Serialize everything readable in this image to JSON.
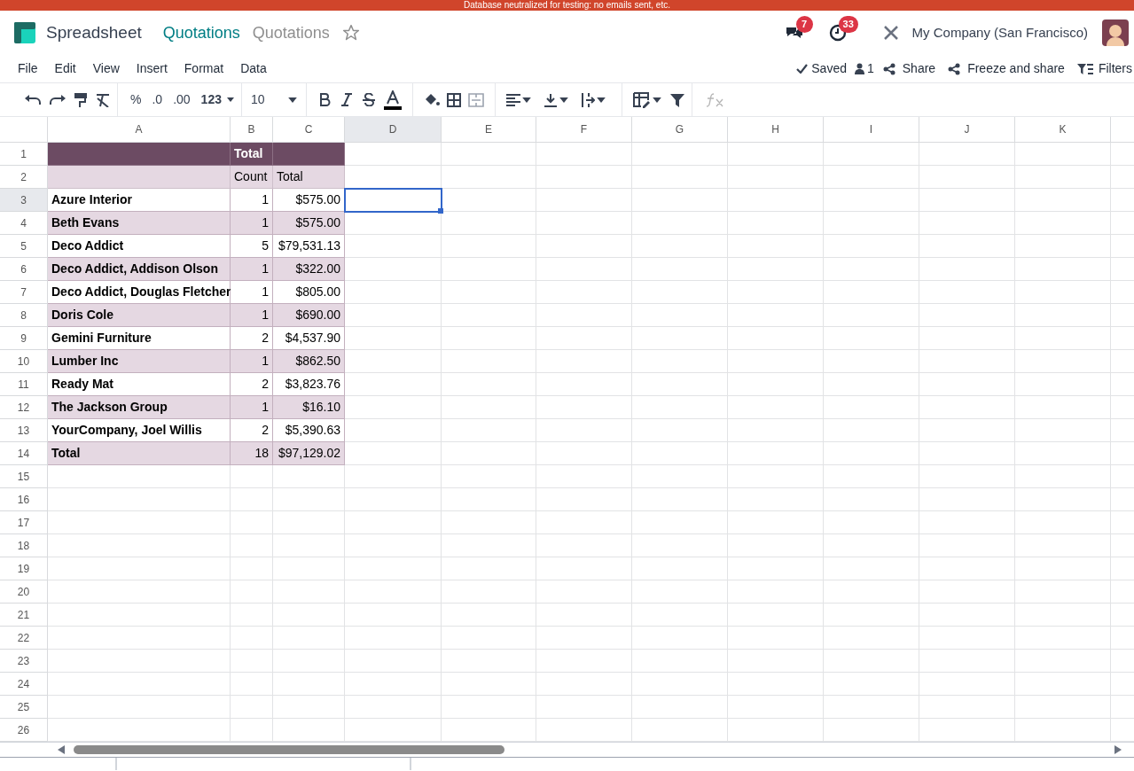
{
  "banner": "Database neutralized for testing: no emails sent, etc.",
  "nav": {
    "app": "Spreadsheet",
    "breadcrumb": "Quotations",
    "document": "Quotations",
    "favorite": false,
    "messages_count": "7",
    "activities_count": "33",
    "company": "My Company (San Francisco)"
  },
  "menu": [
    "File",
    "Edit",
    "View",
    "Insert",
    "Format",
    "Data"
  ],
  "actions": {
    "saved": "Saved",
    "users": "1",
    "share": "Share",
    "freeze": "Freeze and share",
    "filters": "Filters"
  },
  "toolbar": {
    "number_formats": [
      "%",
      ".0",
      ".00",
      "123"
    ],
    "font_size": "10"
  },
  "columns": [
    {
      "label": "A",
      "selected": false
    },
    {
      "label": "B",
      "selected": false
    },
    {
      "label": "C",
      "selected": false
    },
    {
      "label": "D",
      "selected": true
    },
    {
      "label": "E",
      "selected": false
    },
    {
      "label": "F",
      "selected": false
    },
    {
      "label": "G",
      "selected": false
    },
    {
      "label": "H",
      "selected": false
    },
    {
      "label": "I",
      "selected": false
    },
    {
      "label": "J",
      "selected": false
    },
    {
      "label": "K",
      "selected": false
    }
  ],
  "row_numbers": [
    {
      "label": "1",
      "selected": false
    },
    {
      "label": "2",
      "selected": false
    },
    {
      "label": "3",
      "selected": true
    },
    {
      "label": "4",
      "selected": false
    },
    {
      "label": "5",
      "selected": false
    },
    {
      "label": "6",
      "selected": false
    },
    {
      "label": "7",
      "selected": false
    },
    {
      "label": "8",
      "selected": false
    },
    {
      "label": "9",
      "selected": false
    },
    {
      "label": "10",
      "selected": false
    },
    {
      "label": "11",
      "selected": false
    },
    {
      "label": "12",
      "selected": false
    },
    {
      "label": "13",
      "selected": false
    },
    {
      "label": "14",
      "selected": false
    },
    {
      "label": "15",
      "selected": false
    },
    {
      "label": "16",
      "selected": false
    },
    {
      "label": "17",
      "selected": false
    },
    {
      "label": "18",
      "selected": false
    },
    {
      "label": "19",
      "selected": false
    },
    {
      "label": "20",
      "selected": false
    },
    {
      "label": "21",
      "selected": false
    },
    {
      "label": "22",
      "selected": false
    },
    {
      "label": "23",
      "selected": false
    },
    {
      "label": "24",
      "selected": false
    },
    {
      "label": "25",
      "selected": false
    },
    {
      "label": "26",
      "selected": false
    }
  ],
  "pivot": {
    "header": "Total",
    "measures": [
      "Count",
      "Total"
    ],
    "rows": [
      {
        "name": "Azure Interior",
        "count": "1",
        "total": "$575.00"
      },
      {
        "name": "Beth Evans",
        "count": "1",
        "total": "$575.00"
      },
      {
        "name": "Deco Addict",
        "count": "5",
        "total": "$79,531.13"
      },
      {
        "name": "Deco Addict, Addison Olson",
        "count": "1",
        "total": "$322.00"
      },
      {
        "name": "Deco Addict, Douglas Fletcher",
        "count": "1",
        "total": "$805.00"
      },
      {
        "name": "Doris Cole",
        "count": "1",
        "total": "$690.00"
      },
      {
        "name": "Gemini Furniture",
        "count": "2",
        "total": "$4,537.90"
      },
      {
        "name": "Lumber Inc",
        "count": "1",
        "total": "$862.50"
      },
      {
        "name": "Ready Mat",
        "count": "2",
        "total": "$3,823.76"
      },
      {
        "name": "The Jackson Group",
        "count": "1",
        "total": "$16.10"
      },
      {
        "name": "YourCompany, Joel Willis",
        "count": "2",
        "total": "$5,390.63"
      },
      {
        "name": "Total",
        "count": "18",
        "total": "$97,129.02"
      }
    ]
  }
}
